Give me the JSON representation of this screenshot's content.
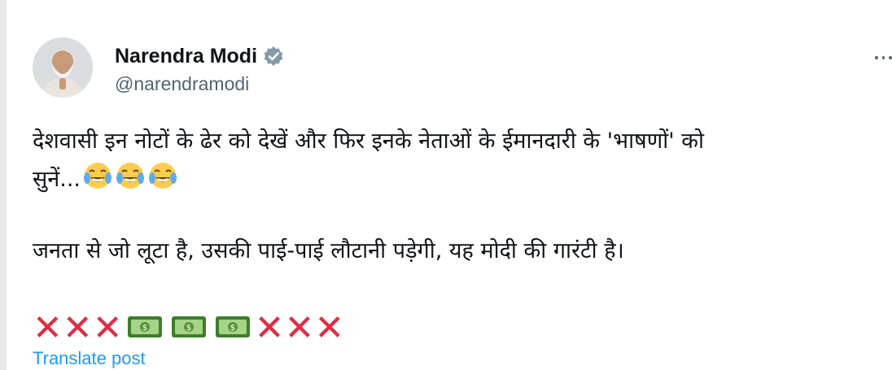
{
  "author": {
    "name": "Narendra Modi",
    "handle": "@narendramodi",
    "verified": true
  },
  "post": {
    "line1": "देशवासी इन नोटों के ढेर को देखें और फिर इनके नेताओं के ईमानदारी के 'भाषणों' को",
    "line2": "सुनें...",
    "line2_emojis": [
      "face-with-tears-of-joy",
      "face-with-tears-of-joy",
      "face-with-tears-of-joy"
    ],
    "para2": "जनता से जो लूटा है, उसकी पाई-पाई लौटानी पड़ेगी, यह मोदी की गारंटी है।",
    "emoji_row": [
      "cross-mark",
      "cross-mark",
      "cross-mark",
      "dollar-banknote",
      "dollar-banknote",
      "dollar-banknote",
      "cross-mark",
      "cross-mark",
      "cross-mark"
    ]
  },
  "actions": {
    "translate_label": "Translate post"
  },
  "colors": {
    "text": "#0f1419",
    "secondary": "#536471",
    "link": "#1d9bf0",
    "verified": "#829aab",
    "cross": "#dd2e44"
  }
}
